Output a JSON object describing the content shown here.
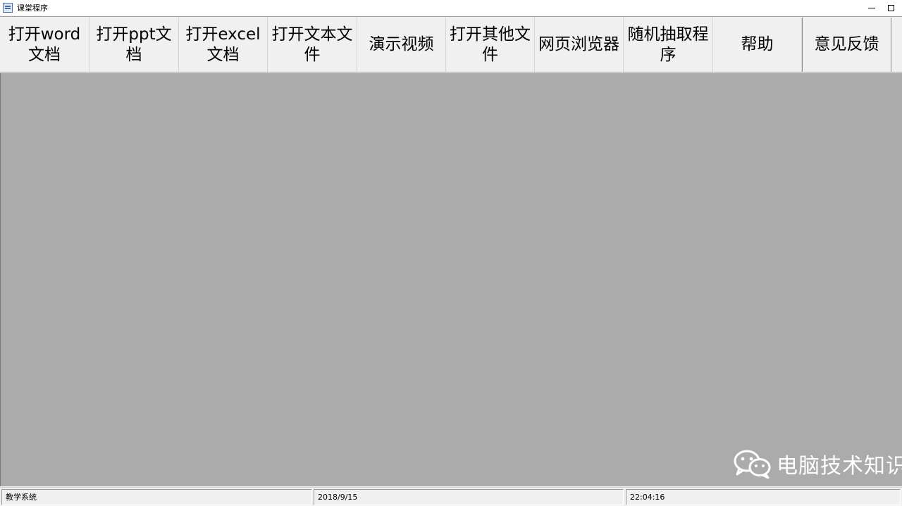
{
  "window": {
    "title": "课堂程序",
    "minimize_glyph": "",
    "maximize_glyph": ""
  },
  "toolbar": {
    "buttons": [
      {
        "label": "打开word文档"
      },
      {
        "label": "打开ppt文档"
      },
      {
        "label": "打开excel文档"
      },
      {
        "label": "打开文本文件"
      },
      {
        "label": "演示视频"
      },
      {
        "label": "打开其他文件"
      },
      {
        "label": "网页浏览器"
      },
      {
        "label": "随机抽取程序"
      },
      {
        "label": "帮助"
      },
      {
        "label": "意见反馈"
      }
    ]
  },
  "watermark": {
    "text": "电脑技术知识",
    "icon": "wechat-icon"
  },
  "statusbar": {
    "panels": [
      {
        "text": "教学系统"
      },
      {
        "text": "2018/9/15"
      },
      {
        "text": "22:04:16"
      }
    ]
  },
  "colors": {
    "client_background": "#ababab",
    "toolbar_background": "#f0f0f0",
    "watermark_text": "#ffffff"
  }
}
